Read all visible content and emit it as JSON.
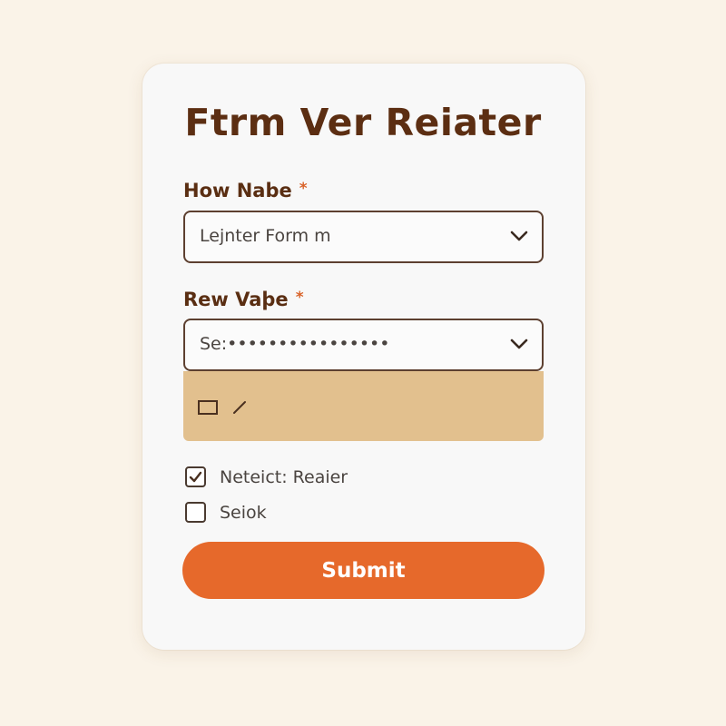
{
  "form": {
    "title": "Ftrm Ver Reiater",
    "field1": {
      "label": "How Nabe",
      "required_mark": "*",
      "value": "Lejnter Form m"
    },
    "field2": {
      "label": "Rew Vaþe",
      "required_mark": "*",
      "value": "Se:••••••••••••••••"
    },
    "checkboxes": [
      {
        "label": "Neteict: Reaier",
        "checked": true
      },
      {
        "label": "Seiok",
        "checked": false
      }
    ],
    "submit_label": "Submit"
  },
  "colors": {
    "background": "#faf3e8",
    "card": "#f8f8f8",
    "title": "#5c2e12",
    "required": "#d9632a",
    "dropdown_panel": "#e2c08e",
    "button": "#e6692b"
  },
  "icons": {
    "select_arrow": "chevron-down-icon",
    "checked": "checkmark-icon",
    "dropdown_option": "square-icon",
    "dropdown_option_mark": "slash-icon"
  }
}
